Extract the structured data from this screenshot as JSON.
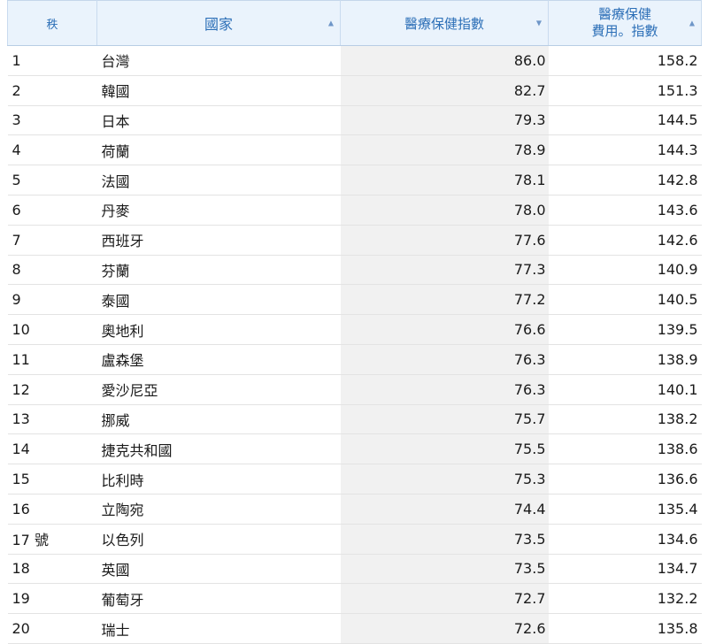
{
  "header": {
    "rank": "秩",
    "country": "國家",
    "index": "醫療保健指數",
    "cost_line1": "醫療保健",
    "cost_line2": "費用。指數",
    "sort_up": "▲",
    "sort_down": "▼"
  },
  "rows": [
    {
      "rank": "1",
      "country": "台灣",
      "index": "86.0",
      "cost": "158.2"
    },
    {
      "rank": "2",
      "country": "韓國",
      "index": "82.7",
      "cost": "151.3"
    },
    {
      "rank": "3",
      "country": "日本",
      "index": "79.3",
      "cost": "144.5"
    },
    {
      "rank": "4",
      "country": "荷蘭",
      "index": "78.9",
      "cost": "144.3"
    },
    {
      "rank": "5",
      "country": "法國",
      "index": "78.1",
      "cost": "142.8"
    },
    {
      "rank": "6",
      "country": "丹麥",
      "index": "78.0",
      "cost": "143.6"
    },
    {
      "rank": "7",
      "country": "西班牙",
      "index": "77.6",
      "cost": "142.6"
    },
    {
      "rank": "8",
      "country": "芬蘭",
      "index": "77.3",
      "cost": "140.9"
    },
    {
      "rank": "9",
      "country": "泰國",
      "index": "77.2",
      "cost": "140.5"
    },
    {
      "rank": "10",
      "country": "奧地利",
      "index": "76.6",
      "cost": "139.5"
    },
    {
      "rank": "11",
      "country": "盧森堡",
      "index": "76.3",
      "cost": "138.9"
    },
    {
      "rank": "12",
      "country": "愛沙尼亞",
      "index": "76.3",
      "cost": "140.1"
    },
    {
      "rank": "13",
      "country": "挪威",
      "index": "75.7",
      "cost": "138.2"
    },
    {
      "rank": "14",
      "country": "捷克共和國",
      "index": "75.5",
      "cost": "138.6"
    },
    {
      "rank": "15",
      "country": "比利時",
      "index": "75.3",
      "cost": "136.6"
    },
    {
      "rank": "16",
      "country": "立陶宛",
      "index": "74.4",
      "cost": "135.4"
    },
    {
      "rank": "17 號",
      "country": "以色列",
      "index": "73.5",
      "cost": "134.6"
    },
    {
      "rank": "18",
      "country": "英國",
      "index": "73.5",
      "cost": "134.7"
    },
    {
      "rank": "19",
      "country": "葡萄牙",
      "index": "72.7",
      "cost": "132.2"
    },
    {
      "rank": "20",
      "country": "瑞士",
      "index": "72.6",
      "cost": "135.8"
    }
  ]
}
